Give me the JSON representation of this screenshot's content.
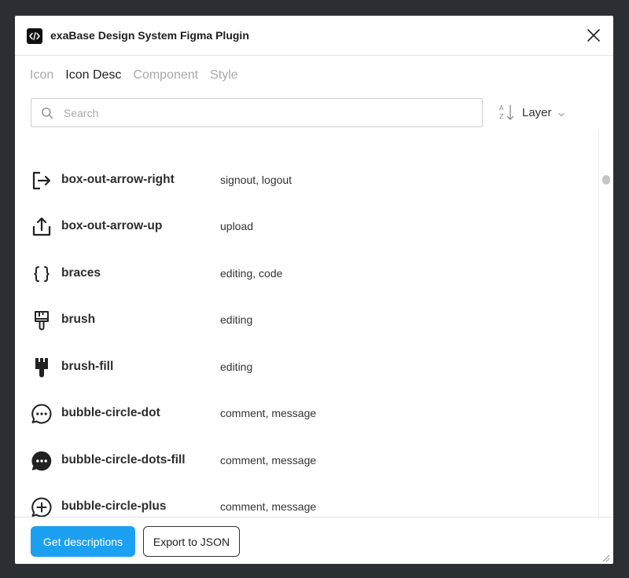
{
  "window": {
    "title": "exaBase Design System Figma Plugin",
    "app_icon": "code-icon",
    "close_icon": "close-icon"
  },
  "tabs": [
    {
      "label": "Icon",
      "active": false
    },
    {
      "label": "Icon Desc",
      "active": true
    },
    {
      "label": "Component",
      "active": false
    },
    {
      "label": "Style",
      "active": false
    }
  ],
  "search": {
    "placeholder": "Search",
    "value": "",
    "icon": "search-icon"
  },
  "sort": {
    "label": "Layer",
    "icon": "sort-az-icon",
    "chevron": "chevron-down-icon"
  },
  "icons": [
    {
      "name": "box-out-arrow-right",
      "desc": "signout, logout",
      "icon": "box-out-arrow-right-icon"
    },
    {
      "name": "box-out-arrow-up",
      "desc": "upload",
      "icon": "box-out-arrow-up-icon"
    },
    {
      "name": "braces",
      "desc": "editing, code",
      "icon": "braces-icon"
    },
    {
      "name": "brush",
      "desc": "editing",
      "icon": "brush-icon"
    },
    {
      "name": "brush-fill",
      "desc": "editing",
      "icon": "brush-fill-icon"
    },
    {
      "name": "bubble-circle-dot",
      "desc": "comment, message",
      "icon": "bubble-circle-dot-icon"
    },
    {
      "name": "bubble-circle-dots-fill",
      "desc": "comment, message",
      "icon": "bubble-circle-dots-fill-icon"
    },
    {
      "name": "bubble-circle-plus",
      "desc": "comment, message",
      "icon": "bubble-circle-plus-icon"
    }
  ],
  "footer": {
    "primary_label": "Get descriptions",
    "secondary_label": "Export to JSON"
  },
  "colors": {
    "primary": "#1ca0f2",
    "backdrop": "#2b2e32",
    "text": "#1e1e1e",
    "muted": "#a8a8a8"
  }
}
